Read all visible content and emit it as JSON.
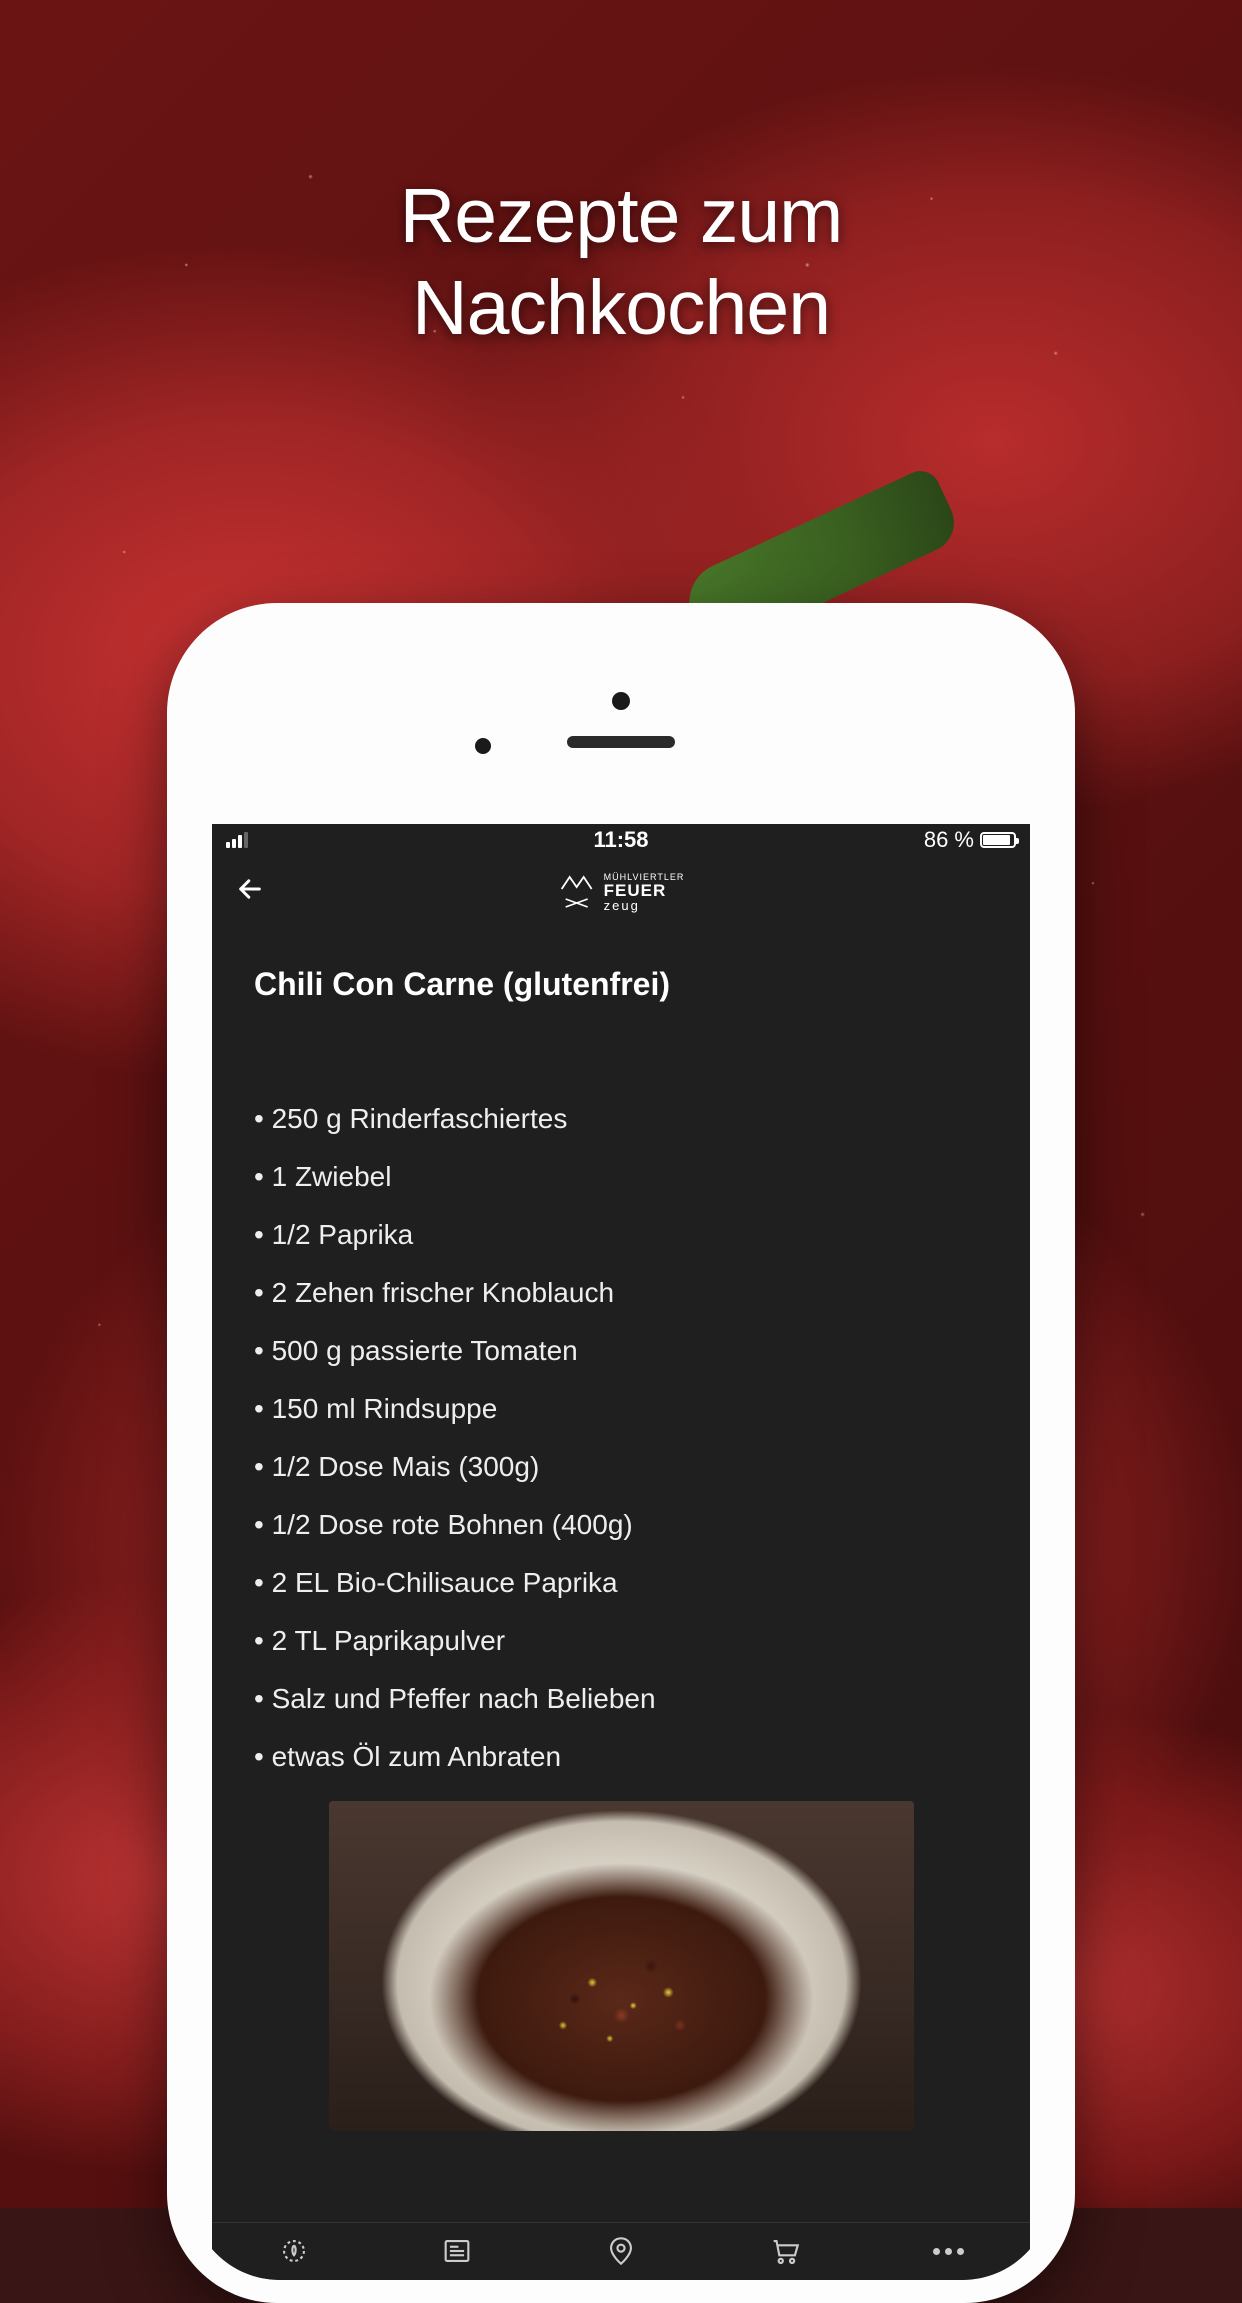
{
  "promo": {
    "title": "Rezepte zum\nNachkochen"
  },
  "status_bar": {
    "time": "11:58",
    "battery_percent": "86 %"
  },
  "app_header": {
    "logo_super": "MÜHLVIERTLER",
    "logo_main": "FEUER",
    "logo_sub": "zeug"
  },
  "recipe": {
    "title": "Chili Con Carne (glutenfrei)",
    "ingredients": [
      "250 g Rinderfaschiertes",
      "1 Zwiebel",
      "1/2 Paprika",
      "2 Zehen frischer Knoblauch",
      "500 g passierte Tomaten",
      "150 ml Rindsuppe",
      "1/2 Dose Mais (300g)",
      "1/2 Dose rote Bohnen (400g)",
      "2 EL Bio-Chilisauce Paprika",
      "2 TL Paprikapulver",
      "Salz und Pfeffer nach Belieben",
      "etwas Öl zum Anbraten"
    ]
  }
}
